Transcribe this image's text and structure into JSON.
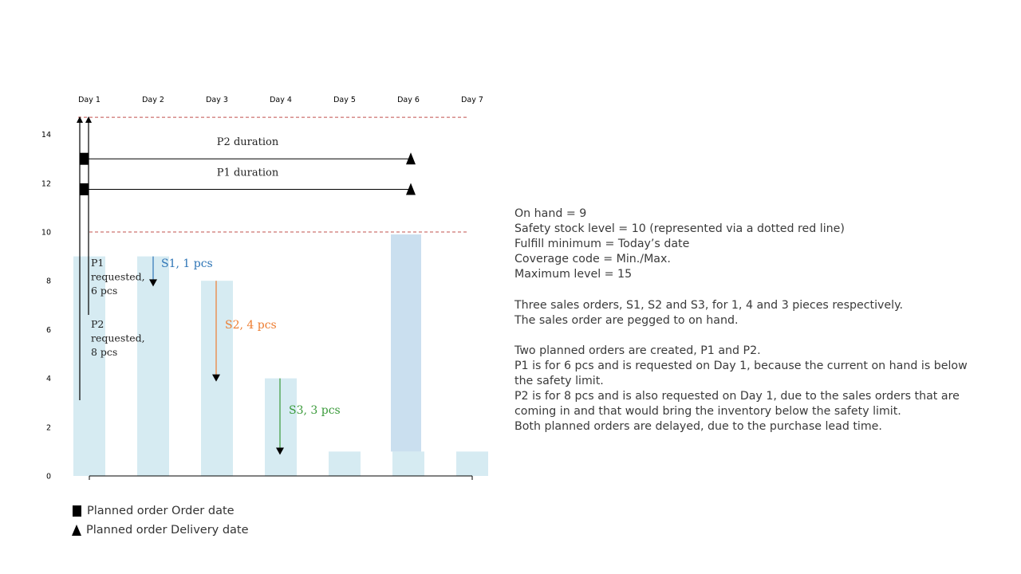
{
  "chart_data": {
    "type": "bar",
    "categories": [
      "Day 1",
      "Day 2",
      "Day 3",
      "Day 4",
      "Day 5",
      "Day 6",
      "Day 7"
    ],
    "series": [
      {
        "values": [
          9,
          9,
          8,
          4,
          1,
          1,
          1
        ]
      },
      {
        "values": [
          null,
          null,
          null,
          null,
          null,
          8.9,
          null
        ]
      }
    ],
    "ylim": [
      0,
      15
    ],
    "yticks": [
      0,
      2,
      4,
      6,
      8,
      10,
      12,
      14
    ],
    "reference_lines": [
      {
        "y": 10,
        "style": "dashed",
        "color": "#c0504d"
      },
      {
        "y": 14.7,
        "style": "dashed",
        "color": "#c0504d"
      }
    ],
    "durations": [
      {
        "label": "P2 duration",
        "y": 13,
        "from_day": 1,
        "to_day": 6
      },
      {
        "label": "P1 duration",
        "y": 11.75,
        "from_day": 1,
        "to_day": 6
      }
    ],
    "annotations": [
      {
        "lines": [
          "P1",
          "requested,",
          "6 pcs"
        ]
      },
      {
        "lines": [
          "P2",
          "requested,",
          "8 pcs"
        ]
      },
      {
        "text": "S1, 1 pcs",
        "color": "#2e75b6",
        "from": 9,
        "to": 7.8
      },
      {
        "text": "S2, 4 pcs",
        "color": "#ed7d31",
        "from": 8,
        "to": 3.9
      },
      {
        "text": "S3, 3 pcs",
        "color": "#3a9a3a",
        "from": 4,
        "to": 0.9
      }
    ],
    "grid": false,
    "legend_position": "bottom-left"
  },
  "colors": {
    "bar": "#d6ebf2",
    "bar_highlight": "#cadfef",
    "reference_line": "#c0504d"
  },
  "legend": {
    "order_date": "Planned order Order date",
    "delivery_date": "Planned order Delivery date"
  },
  "notes": {
    "block1": [
      "On hand = 9",
      "Safety stock level = 10 (represented via a dotted red line)",
      "Fulfill minimum = Today’s date",
      "Coverage code = Min./Max.",
      "Maximum level = 15"
    ],
    "block2": [
      "Three sales orders, S1, S2 and S3, for 1, 4 and 3 pieces respectively.",
      "The sales order are pegged to on hand."
    ],
    "block3": [
      "Two planned orders are created, P1 and P2.",
      "P1 is for 6 pcs and is requested on Day 1, because the current on hand is below",
      "the safety limit.",
      "P2 is for 8 pcs and is also requested on Day 1, due to the sales orders that are",
      "coming in and that would bring the inventory below the safety limit.",
      "Both planned orders are delayed, due to the purchase lead time."
    ]
  }
}
